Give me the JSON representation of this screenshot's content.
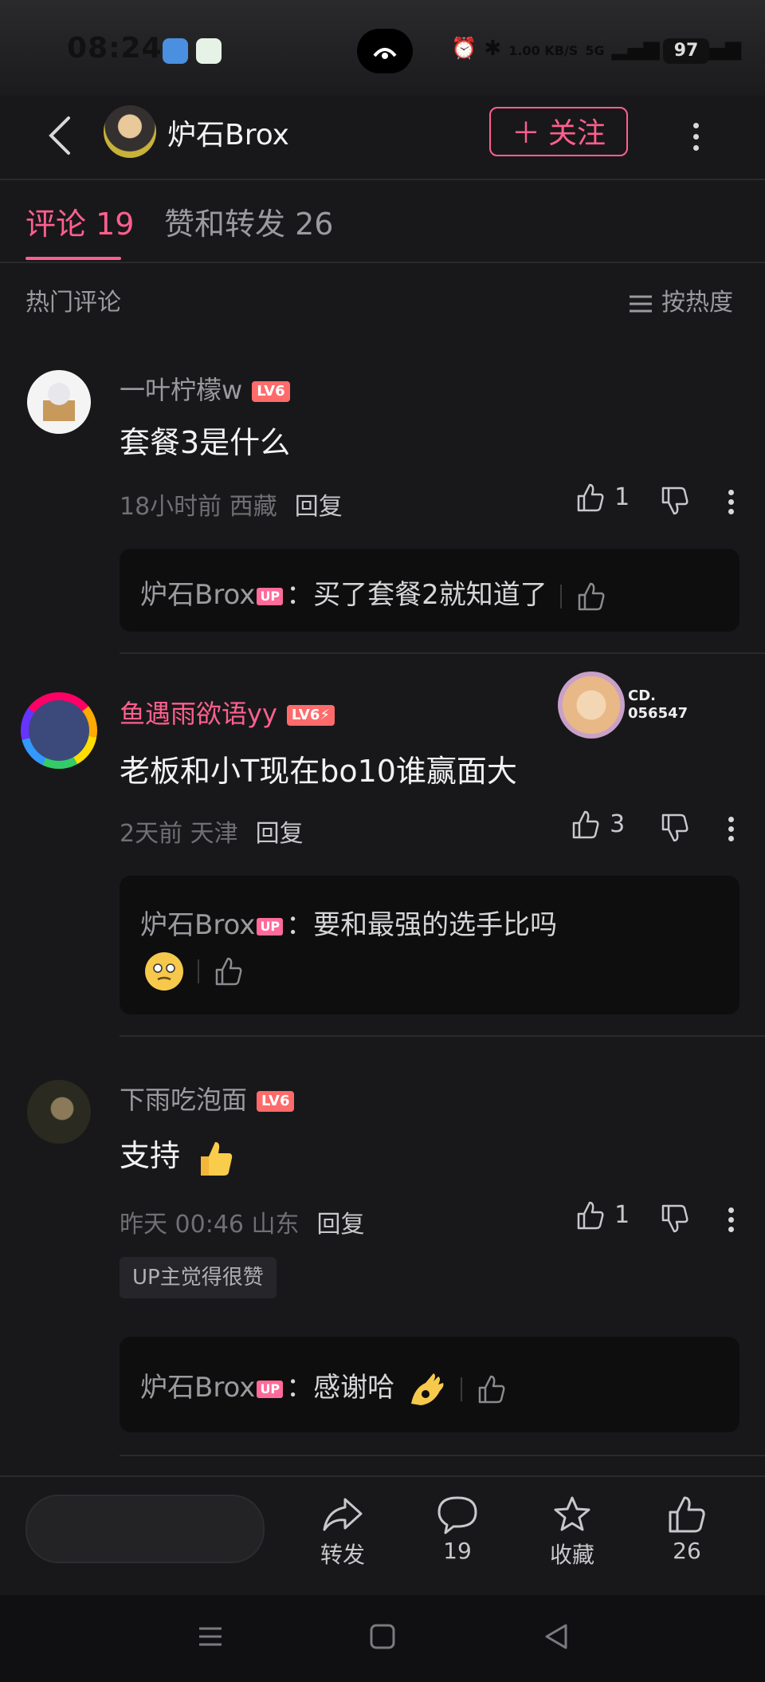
{
  "status_bar": {
    "time": "08:24",
    "network_speed": "1.00 KB/S",
    "signal_1": "5G",
    "signal_2": "5G",
    "battery": "97"
  },
  "header": {
    "title": "炉石Brox",
    "follow_label": "＋ 关注"
  },
  "tabs": [
    {
      "label": "评论 19",
      "active": true
    },
    {
      "label": "赞和转发 26",
      "active": false
    }
  ],
  "section": {
    "hot_label": "热门评论",
    "sort_label": "按热度"
  },
  "comments": [
    {
      "user": "一叶柠檬w",
      "level": "LV6",
      "text": "套餐3是什么",
      "meta": "18小时前 西藏",
      "reply_label": "回复",
      "likes": "1",
      "reply": {
        "user": "炉石Brox",
        "up_badge": "UP",
        "text": "：买了套餐2就知道了"
      }
    },
    {
      "user": "鱼遇雨欲语yy",
      "level": "LV6⚡",
      "text": "老板和小T现在bo10谁赢面大",
      "meta": "2天前 天津",
      "reply_label": "回复",
      "likes": "3",
      "fan_badge": "CD. 056547",
      "reply": {
        "user": "炉石Brox",
        "up_badge": "UP",
        "text": "：要和最强的选手比吗"
      }
    },
    {
      "user": "下雨吃泡面",
      "level": "LV6",
      "text": "支持",
      "meta": "昨天 00:46 山东",
      "reply_label": "回复",
      "likes": "1",
      "up_liked_badge": "UP主觉得很赞",
      "reply": {
        "user": "炉石Brox",
        "up_badge": "UP",
        "text": "：感谢哈"
      }
    }
  ],
  "bottom_actions": [
    {
      "icon": "share-icon",
      "label": "转发"
    },
    {
      "icon": "comment-icon",
      "label": "19"
    },
    {
      "icon": "star-icon",
      "label": "收藏"
    },
    {
      "icon": "thumb-up-icon",
      "label": "26"
    }
  ],
  "colors": {
    "accent": "#ff5f8e",
    "background": "#18181a",
    "reply_box": "#0e0e0f",
    "level_badge": "#ff6b6b"
  }
}
